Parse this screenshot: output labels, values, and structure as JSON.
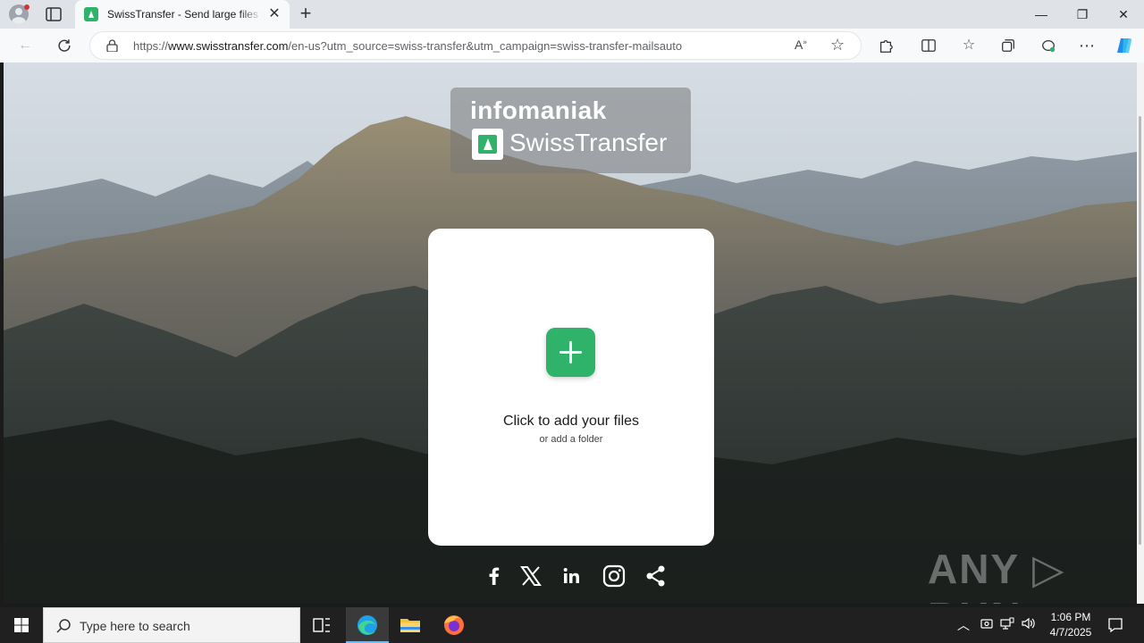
{
  "browser": {
    "tab": {
      "title": "SwissTransfer - Send large files securely",
      "close_glyph": "✕"
    },
    "new_tab_glyph": "+",
    "window_controls": {
      "minimize": "—",
      "restore": "❐",
      "close": "✕"
    },
    "url": {
      "prefix": "https://",
      "domain": "www.swisstransfer.com",
      "path": "/en-us?utm_source=swiss-transfer&utm_campaign=swiss-transfer-mailsauto"
    }
  },
  "page": {
    "brand_top": "infomaniak",
    "brand_name": "SwissTransfer",
    "card": {
      "title": "Click to add your files",
      "subtitle": "or add a folder"
    },
    "watermark": "ANY ▷ RUN",
    "social_icons": [
      "facebook-icon",
      "x-icon",
      "linkedin-icon",
      "instagram-icon",
      "share-icon"
    ]
  },
  "taskbar": {
    "search_placeholder": "Type here to search",
    "time": "1:06 PM",
    "date": "4/7/2025"
  },
  "colors": {
    "brand_green": "#2fb36b",
    "taskbar": "#202020"
  }
}
